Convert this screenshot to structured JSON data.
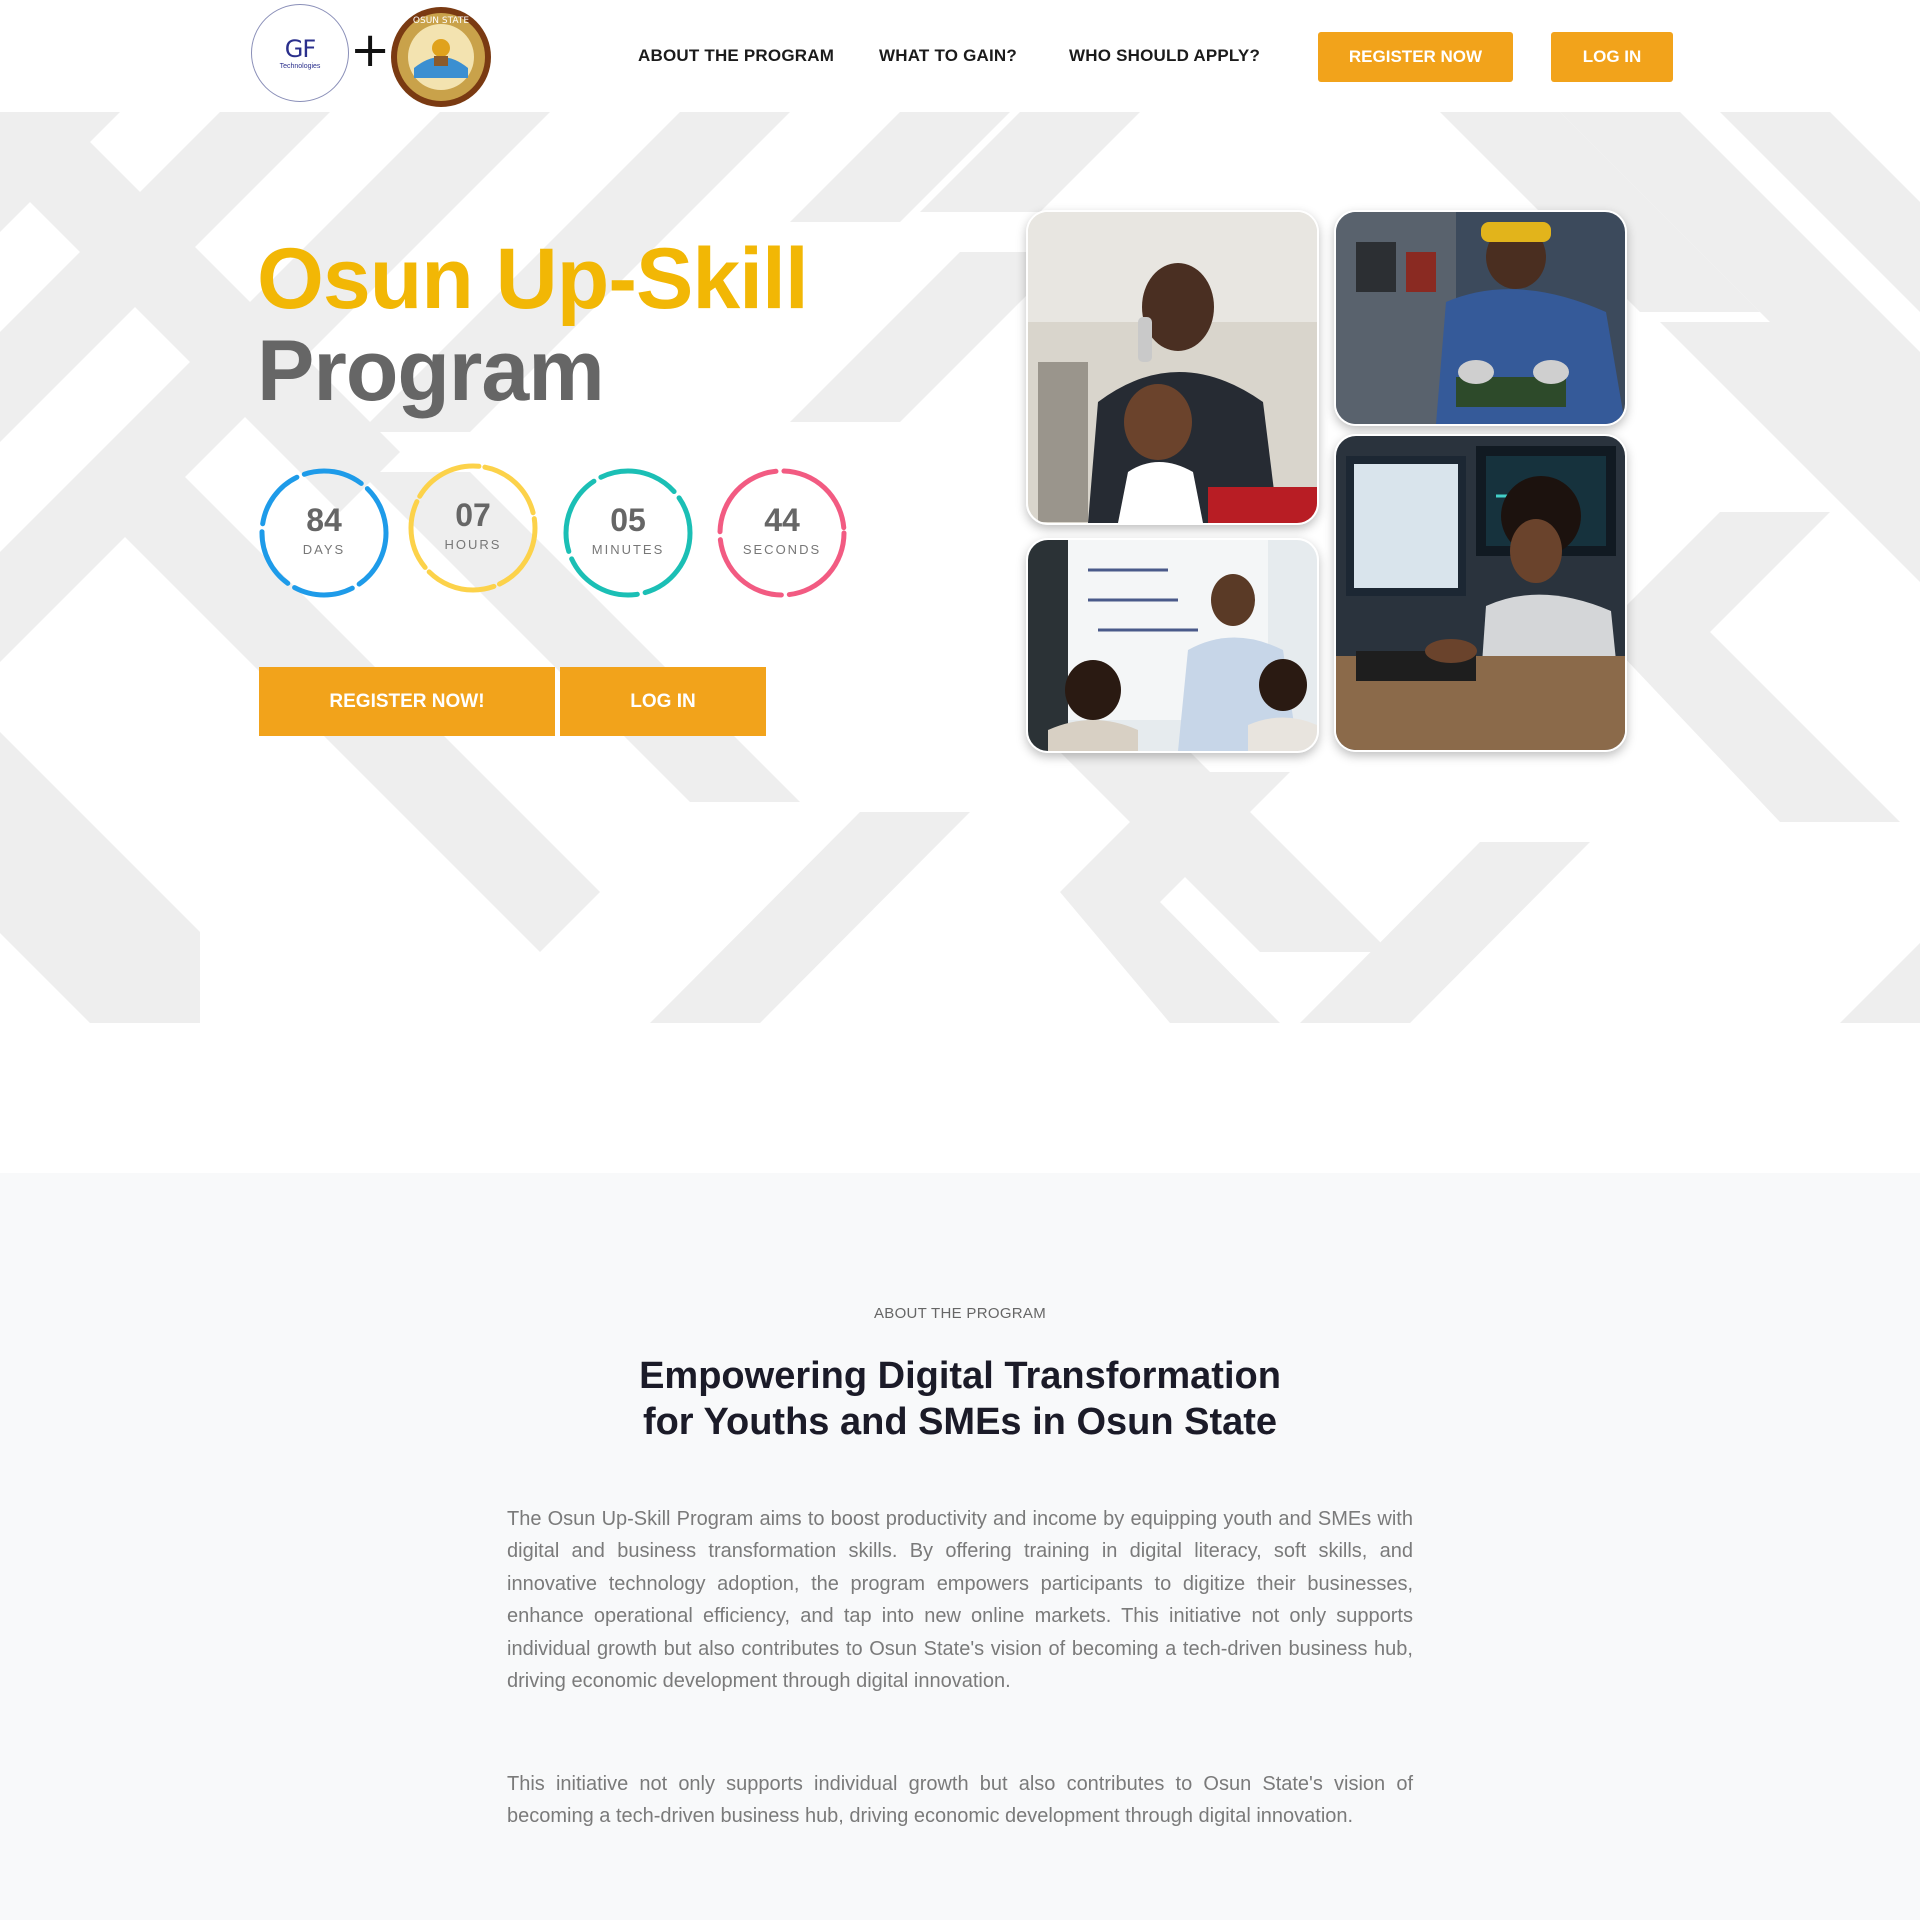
{
  "header": {
    "logo_gf": {
      "mark": "GF",
      "sub": "Technologies"
    },
    "plus": "+",
    "logo_osun": {
      "ring_text": "OSUN STATE"
    },
    "nav": [
      {
        "label": "ABOUT THE PROGRAM"
      },
      {
        "label": "WHAT TO GAIN?"
      },
      {
        "label": "WHO SHOULD APPLY?"
      }
    ],
    "register_label": "REGISTER NOW",
    "login_label": "LOG IN"
  },
  "hero": {
    "title_line1": "Osun Up-Skill",
    "title_line2": "Program",
    "countdown": [
      {
        "value": "84",
        "label": "DAYS",
        "color": "#1e9be9"
      },
      {
        "value": "07",
        "label": "HOURS",
        "color": "#fcd24a"
      },
      {
        "value": "05",
        "label": "MINUTES",
        "color": "#1bbfb5"
      },
      {
        "value": "44",
        "label": "SECONDS",
        "color": "#f25b82"
      }
    ],
    "register_label": "REGISTER NOW!",
    "login_label": "LOG IN"
  },
  "about": {
    "eyebrow": "ABOUT THE PROGRAM",
    "heading_line1": "Empowering Digital Transformation",
    "heading_line2": "for Youths and SMEs in Osun State",
    "paragraph1": "The Osun Up-Skill Program aims to boost productivity and income by equipping youth and SMEs with digital and business transformation skills. By offering training in digital literacy, soft skills, and innovative technology adoption, the program empowers participants to digitize their businesses, enhance operational efficiency, and tap into new online markets. This initiative not only supports individual growth but also contributes to Osun State's vision of becoming a tech-driven business hub, driving economic development through digital innovation.",
    "paragraph2": "This initiative not only supports individual growth but also contributes to Osun State's vision of becoming a tech-driven business hub, driving economic development through digital innovation."
  },
  "colors": {
    "accent": "#f2a31b",
    "title_yellow": "#f2b705",
    "title_gray": "#666666"
  }
}
